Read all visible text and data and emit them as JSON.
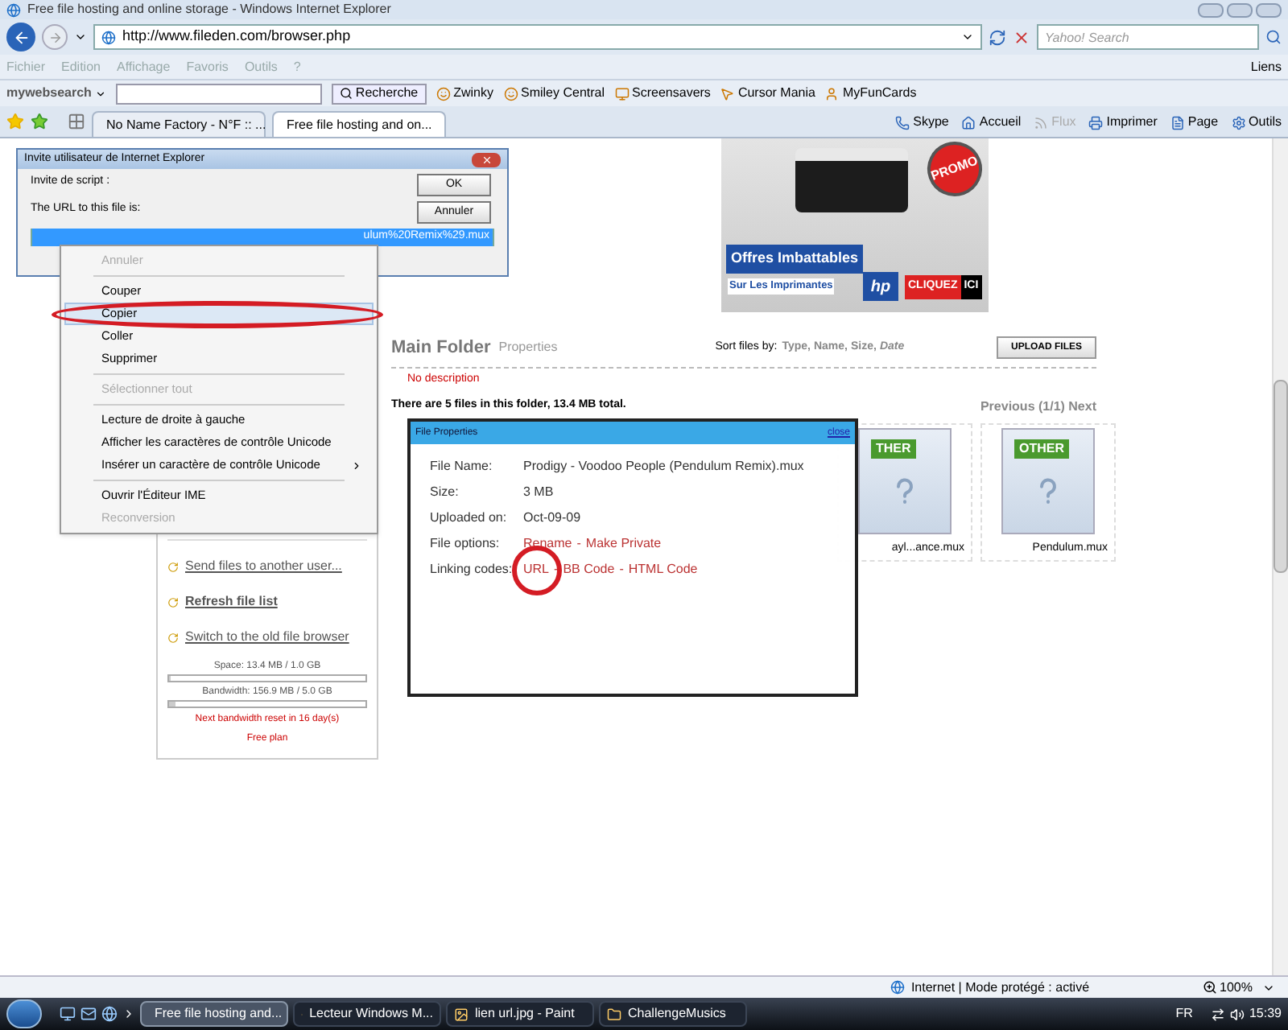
{
  "window": {
    "title": "Free file hosting and online storage - Windows Internet Explorer"
  },
  "address_bar": {
    "url": "http://www.fileden.com/browser.php"
  },
  "search_field": {
    "placeholder": "Yahoo! Search"
  },
  "menu_bar": {
    "items": [
      {
        "label": "Fichier",
        "disabled": true
      },
      {
        "label": "Edition",
        "disabled": true
      },
      {
        "label": "Affichage",
        "disabled": true
      },
      {
        "label": "Favoris",
        "disabled": true
      },
      {
        "label": "Outils",
        "disabled": true
      },
      {
        "label": "?",
        "disabled": true
      }
    ],
    "links": "Liens"
  },
  "search_toolbar": {
    "logo": "my**web**search",
    "button": "Recherche",
    "items": [
      "Zwinky",
      "Smiley Central",
      "Screensavers",
      "Cursor Mania",
      "MyFunCards"
    ]
  },
  "tabs": [
    {
      "label": "No Name Factory - N°F :: ...",
      "selected": false
    },
    {
      "label": "Free file hosting and on...",
      "selected": true
    }
  ],
  "command_bar": [
    {
      "label": "Skype",
      "disabled": false
    },
    {
      "label": "Accueil",
      "disabled": false
    },
    {
      "label": "Flux",
      "disabled": true
    },
    {
      "label": "Imprimer",
      "disabled": false
    },
    {
      "label": "Page",
      "disabled": false
    },
    {
      "label": "Outils",
      "disabled": false
    }
  ],
  "sidebar": {
    "links": [
      {
        "label": "Send files to another user...",
        "emphasized": false
      },
      {
        "label": "Refresh file list",
        "emphasized": true
      },
      {
        "label": "Switch to the old file browser",
        "emphasized": false
      }
    ],
    "space": {
      "label": "Space: 13.4 MB / 1.0 GB",
      "level": 0.01
    },
    "bandwidth": {
      "label": "Bandwidth: 156.9 MB / 5.0 GB",
      "level": 0.03
    },
    "reset_note": "Next bandwidth reset in 16 day(s)",
    "plan": "Free plan"
  },
  "ad": {
    "promo": "PROMO",
    "headline": "Offres Imbattables",
    "subline": "Sur Les Imprimantes",
    "brand": "hp",
    "cta": "CLIQUEZ",
    "cta_end": "ICI"
  },
  "folder": {
    "title": "Main Folder",
    "properties": "Properties",
    "sort_label": "Sort files by:",
    "sort_options": [
      {
        "label": "Type,",
        "selected": false
      },
      {
        "label": "Name,",
        "selected": false
      },
      {
        "label": "Size,",
        "selected": false
      },
      {
        "label": "Date",
        "selected": true
      }
    ],
    "upload_button": "UPLOAD FILES",
    "description": "No description",
    "summary": "There are 5 files in this folder, 13.4 MB total.",
    "pagination": "Previous (1/1) Next"
  },
  "files": [
    {
      "badge": "THER",
      "name": "ayl...ance.mux"
    },
    {
      "badge": "OTHER",
      "name": "Pendulum.mux"
    }
  ],
  "file_properties": {
    "title": "File Properties",
    "close": "close",
    "rows": [
      {
        "kind": "text",
        "label": "File Name:",
        "value": "Prodigy - Voodoo People (Pendulum Remix).mux"
      },
      {
        "kind": "text",
        "label": "Size:",
        "value": "3 MB"
      },
      {
        "kind": "text",
        "label": "Uploaded on:",
        "value": "Oct-09-09"
      },
      {
        "kind": "links",
        "label": "File options:",
        "links": [
          "Rename",
          "Make Private"
        ],
        "separators": [
          "-"
        ]
      },
      {
        "kind": "links",
        "label": "Linking codes:",
        "links": [
          "URL",
          "BB Code",
          "HTML Code"
        ],
        "separators": [
          "-",
          "-"
        ]
      }
    ]
  },
  "prompt_dialog": {
    "title": "Invite utilisateur de Internet Explorer",
    "prompt": "Invite de script :",
    "message": "The URL to this file is:",
    "value": "ulum%20Remix%29.mux",
    "buttons": [
      "OK",
      "Annuler"
    ]
  },
  "context_menu": {
    "items": [
      {
        "kind": "item",
        "label": "Annuler",
        "disabled": true,
        "selected": false,
        "submenu": false
      },
      {
        "kind": "separator"
      },
      {
        "kind": "item",
        "label": "Couper",
        "disabled": false,
        "selected": false,
        "submenu": false
      },
      {
        "kind": "item",
        "label": "Copier",
        "disabled": false,
        "selected": true,
        "submenu": false
      },
      {
        "kind": "item",
        "label": "Coller",
        "disabled": false,
        "selected": false,
        "submenu": false
      },
      {
        "kind": "item",
        "label": "Supprimer",
        "disabled": false,
        "selected": false,
        "submenu": false
      },
      {
        "kind": "separator"
      },
      {
        "kind": "item",
        "label": "Sélectionner tout",
        "disabled": true,
        "selected": false,
        "submenu": false
      },
      {
        "kind": "separator"
      },
      {
        "kind": "item",
        "label": "Lecture de droite à gauche",
        "disabled": false,
        "selected": false,
        "submenu": false
      },
      {
        "kind": "item",
        "label": "Afficher les caractères de contrôle Unicode",
        "disabled": false,
        "selected": false,
        "submenu": false
      },
      {
        "kind": "item",
        "label": "Insérer un caractère de contrôle Unicode",
        "disabled": false,
        "selected": false,
        "submenu": true
      },
      {
        "kind": "separator"
      },
      {
        "kind": "item",
        "label": "Ouvrir l'Éditeur IME",
        "disabled": false,
        "selected": false,
        "submenu": false
      },
      {
        "kind": "item",
        "label": "Reconversion",
        "disabled": true,
        "selected": false,
        "submenu": false
      }
    ]
  },
  "status_bar": {
    "zone": "Internet | Mode protégé : activé",
    "zoom": "100%"
  },
  "taskbar": {
    "items": [
      {
        "label": "Free file hosting and...",
        "selected": true
      },
      {
        "label": "Lecteur Windows M...",
        "selected": false
      },
      {
        "label": "lien url.jpg - Paint",
        "selected": false
      },
      {
        "label": "ChallengeMusics",
        "selected": false
      }
    ],
    "language": "FR",
    "clock": "15:39"
  }
}
